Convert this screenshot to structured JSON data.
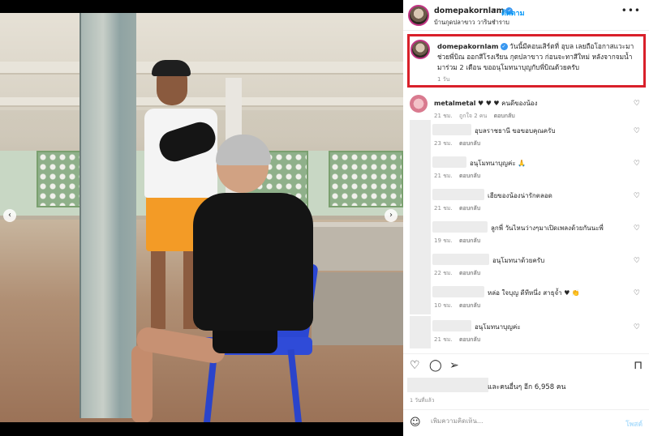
{
  "post": {
    "username": "domepakornlam",
    "follow_label": "ติดตาม",
    "dot": "•",
    "location": "บ้านกุดปลาขาว วารินชำราบ",
    "more_icon": "more-horizontal-icon",
    "caption": "วันนี้มีคอนเสิร์ตที่ อุบล เลยถือโอกาสแวะมาช่วยพี่บิณ ออกสีโรงเรียน กุดปลาขาว ก่อนจะทาสีใหม่ หลังจากจมน้ำมาร่วม 2 เดือน ขออนุโมทนาบุญกับพี่บิณด้วยครับ",
    "caption_time": "1 วัน"
  },
  "comments": [
    {
      "username": "metalmetal",
      "text": "♥ ♥ ♥ คนดีของน้อง",
      "time": "21 ชม.",
      "likes": "ถูกใจ 2 คน",
      "reply": "ตอบกลับ",
      "blurred": false
    },
    {
      "username": "",
      "text": "อุบลราชธานี ขอขอบคุณครับ",
      "time": "23 ชม.",
      "likes": "",
      "reply": "ตอบกลับ",
      "blurred": true
    },
    {
      "username": "",
      "text": "อนุโมทนาบุญค่ะ 🙏",
      "time": "21 ชม.",
      "likes": "",
      "reply": "ตอบกลับ",
      "blurred": true
    },
    {
      "username": "",
      "text": "เฮียของน้องน่ารักตลอด",
      "time": "21 ชม.",
      "likes": "",
      "reply": "ตอบกลับ",
      "blurred": true
    },
    {
      "username": "",
      "text": "ลูกพี่ วันไหนว่างๆมาเปิดเพลงด้วยกันนะพี่",
      "time": "19 ชม.",
      "likes": "",
      "reply": "ตอบกลับ",
      "blurred": true
    },
    {
      "username": "",
      "text": "อนุโมทนาด้วยครับ",
      "time": "22 ชม.",
      "likes": "",
      "reply": "ตอบกลับ",
      "blurred": true
    },
    {
      "username": "",
      "text": "หล่อ ใจบุญ ดีทีหนึ่ง สาธุจ้ำ ♥ 👏",
      "time": "10 ชม.",
      "likes": "",
      "reply": "ตอบกลับ",
      "blurred": true
    },
    {
      "username": "",
      "text": "อนุโมทนาบุญค่ะ",
      "time": "21 ชม.",
      "likes": "",
      "reply": "ตอบกลับ",
      "blurred": true
    }
  ],
  "actions": {
    "like_icon": "heart-icon",
    "comment_icon": "comment-icon",
    "share_icon": "send-icon",
    "save_icon": "bookmark-icon"
  },
  "likes_text": "และคนอื่นๆ อีก 6,958 คน",
  "post_time": "1 วันที่แล้ว",
  "add_comment": {
    "placeholder": "เพิ่มความคิดเห็น...",
    "post_label": "โพสต์"
  },
  "colors": {
    "accent": "#0095f6",
    "highlight_border": "#d9202a",
    "heart_red": "#ed4956"
  }
}
